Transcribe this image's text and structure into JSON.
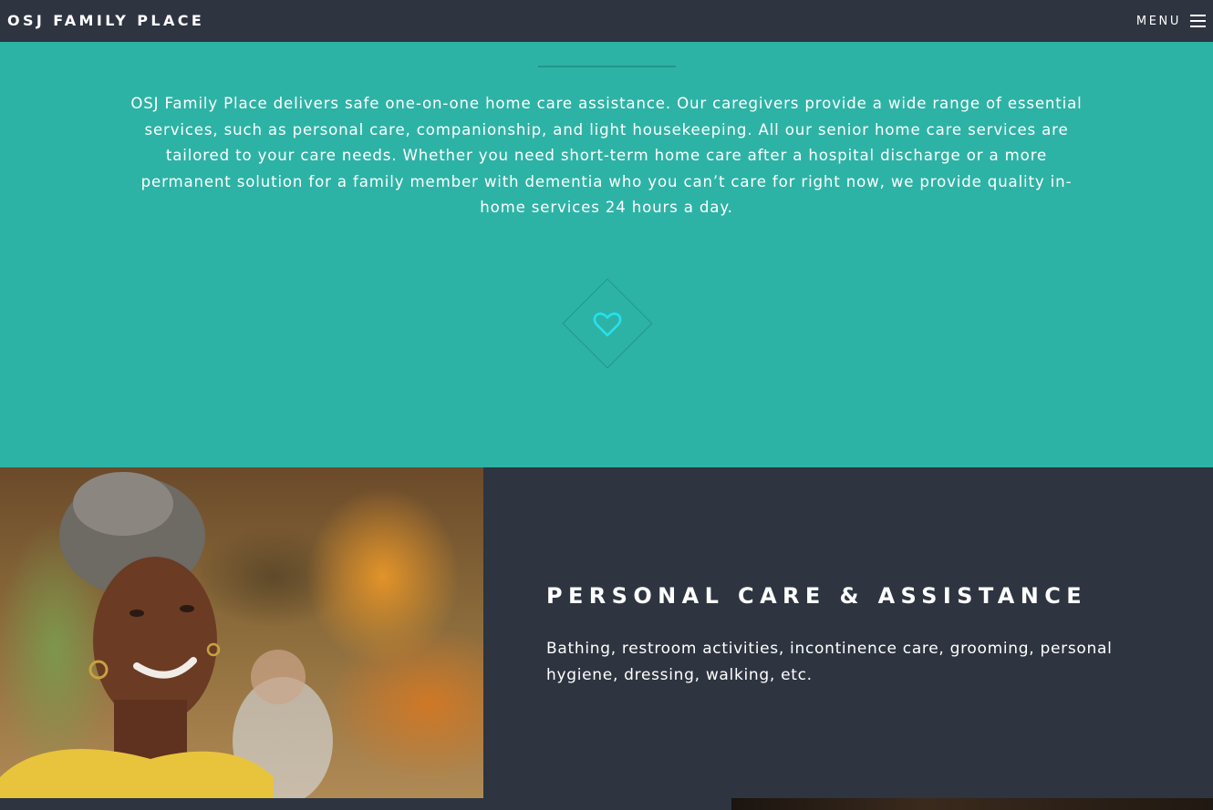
{
  "header": {
    "brand": "OSJ FAMILY PLACE",
    "menu_label": "MENU",
    "menu_icon": "hamburger-icon"
  },
  "intro": {
    "text": "OSJ Family Place delivers safe one-on-one home care assistance. Our caregivers provide a wide range of essential services, such as personal care, companionship, and light housekeeping. All our senior home care services are tailored to your care needs. Whether you need short-term home care after a hospital discharge or a more permanent solution for a family member with dementia who you can’t care for right now, we provide quality in-home services 24 hours a day.",
    "icon": "heart-icon"
  },
  "feature": {
    "title": "PERSONAL CARE & ASSISTANCE",
    "description": "Bathing, restroom activities, incontinence care, grooming, personal hygiene, dressing, walking, etc."
  },
  "colors": {
    "header_bg": "#2e3440",
    "teal": "#2db3a5",
    "teal_dark": "#23958a",
    "heart": "#27e0f0",
    "text": "#ffffff"
  }
}
